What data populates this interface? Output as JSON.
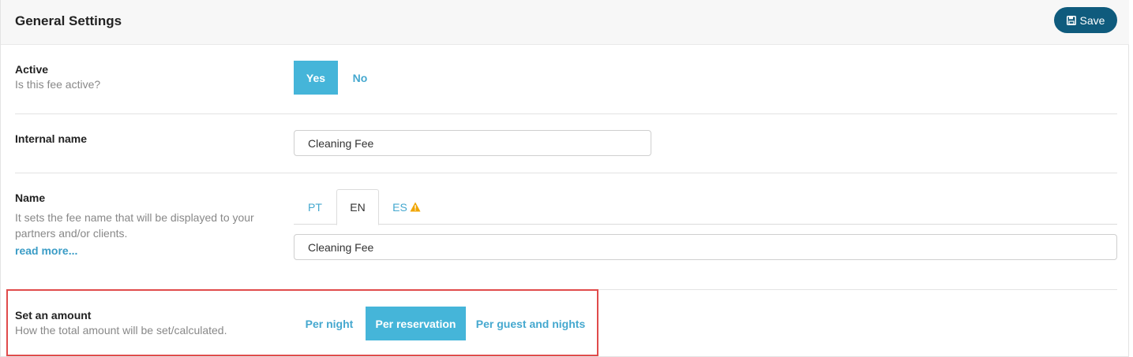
{
  "header": {
    "title": "General Settings",
    "save_label": "Save",
    "save_icon": "floppy-disk-icon"
  },
  "active": {
    "label": "Active",
    "help": "Is this fee active?",
    "options": [
      "Yes",
      "No"
    ],
    "selected": "Yes"
  },
  "internal_name": {
    "label": "Internal name",
    "value": "Cleaning Fee"
  },
  "name": {
    "label": "Name",
    "help_line1": "It sets the fee name that will be displayed to your",
    "help_line2": "partners and/or clients.",
    "read_more": "read more...",
    "tabs": [
      "PT",
      "EN",
      "ES"
    ],
    "selected_tab": "EN",
    "warning_tab": "ES",
    "value": "Cleaning Fee"
  },
  "amount": {
    "label": "Set an amount",
    "help": "How the total amount will be set/calculated.",
    "options": [
      "Per night",
      "Per reservation",
      "Per guest and nights"
    ],
    "selected": "Per reservation"
  },
  "colors": {
    "accent": "#45b5d9",
    "primary": "#0f5b7d",
    "highlight": "#e04b4b",
    "warning": "#f0a500"
  }
}
